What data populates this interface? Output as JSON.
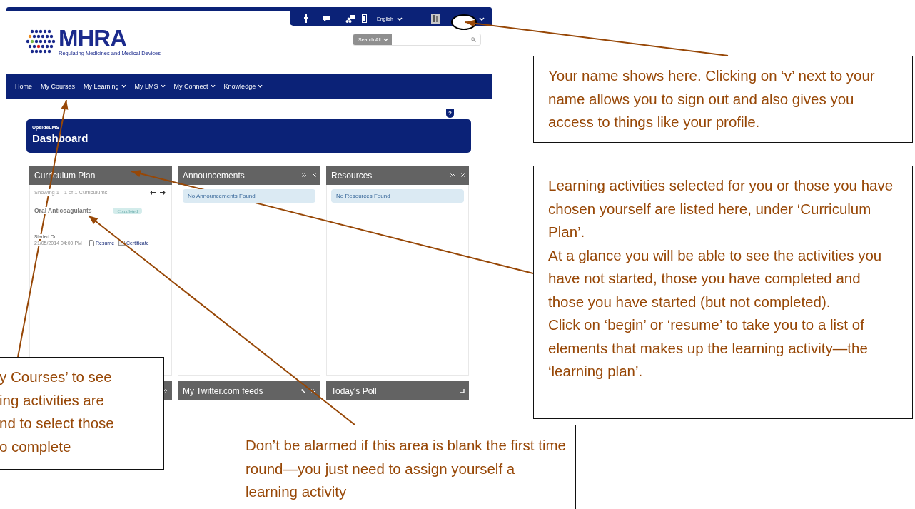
{
  "top_bar": {
    "language": "English"
  },
  "logo": {
    "name": "MHRA",
    "tagline": "Regulating Medicines and Medical Devices"
  },
  "search": {
    "scope": "Search All"
  },
  "nav": [
    {
      "label": "Home",
      "dropdown": false
    },
    {
      "label": "My Courses",
      "dropdown": false
    },
    {
      "label": "My Learning",
      "dropdown": true
    },
    {
      "label": "My LMS",
      "dropdown": true
    },
    {
      "label": "My Connect",
      "dropdown": true
    },
    {
      "label": "Knowledge",
      "dropdown": true
    }
  ],
  "page": {
    "breadcrumb": "UpsideLMS",
    "title": "Dashboard"
  },
  "panels": [
    {
      "kind": "curriculum",
      "title": "Curriculum Plan",
      "pager": "Showing 1 - 1 of 1 Curriculums",
      "item": {
        "title": "Oral Anticoagulants",
        "status": "Completed",
        "started_label": "Started On:",
        "started": "21/05/2014 04:00 PM",
        "actions": [
          "Resume",
          "Certificate"
        ]
      }
    },
    {
      "kind": "message",
      "title": "Announcements",
      "message": "No Announcements Found"
    },
    {
      "kind": "message",
      "title": "Resources",
      "message": "No Resources Found"
    }
  ],
  "help": "?",
  "bottom_panels": [
    {
      "kind": "covered"
    },
    {
      "kind": "feed",
      "title": "My Twitter.com feeds"
    },
    {
      "kind": "poll",
      "title": "Today's Poll"
    }
  ],
  "callouts": [
    {
      "paragraphs": [
        "Your name shows here. Clicking on ‘v’ next to your name allows you to sign out and also gives you access to things like your profile."
      ]
    },
    {
      "paragraphs": [
        "Learning activities selected for you or those you have chosen yourself are listed here, under ‘Curriculum Plan’.",
        "At a glance you will be able to see the activities you have not started, those you have completed and those you have started (but not completed).",
        "Click on ‘begin’ or ‘resume’ to take you to a list of elements that makes up the learning activity—the ‘learning plan’."
      ]
    },
    {
      "paragraphs": [
        "Don’t be alarmed if this area is blank the first time round—you just need to assign yourself a learning activity"
      ]
    },
    {
      "lines": [
        "y Courses’ to see",
        "ing activities are",
        "nd to select those",
        "o complete"
      ]
    }
  ]
}
